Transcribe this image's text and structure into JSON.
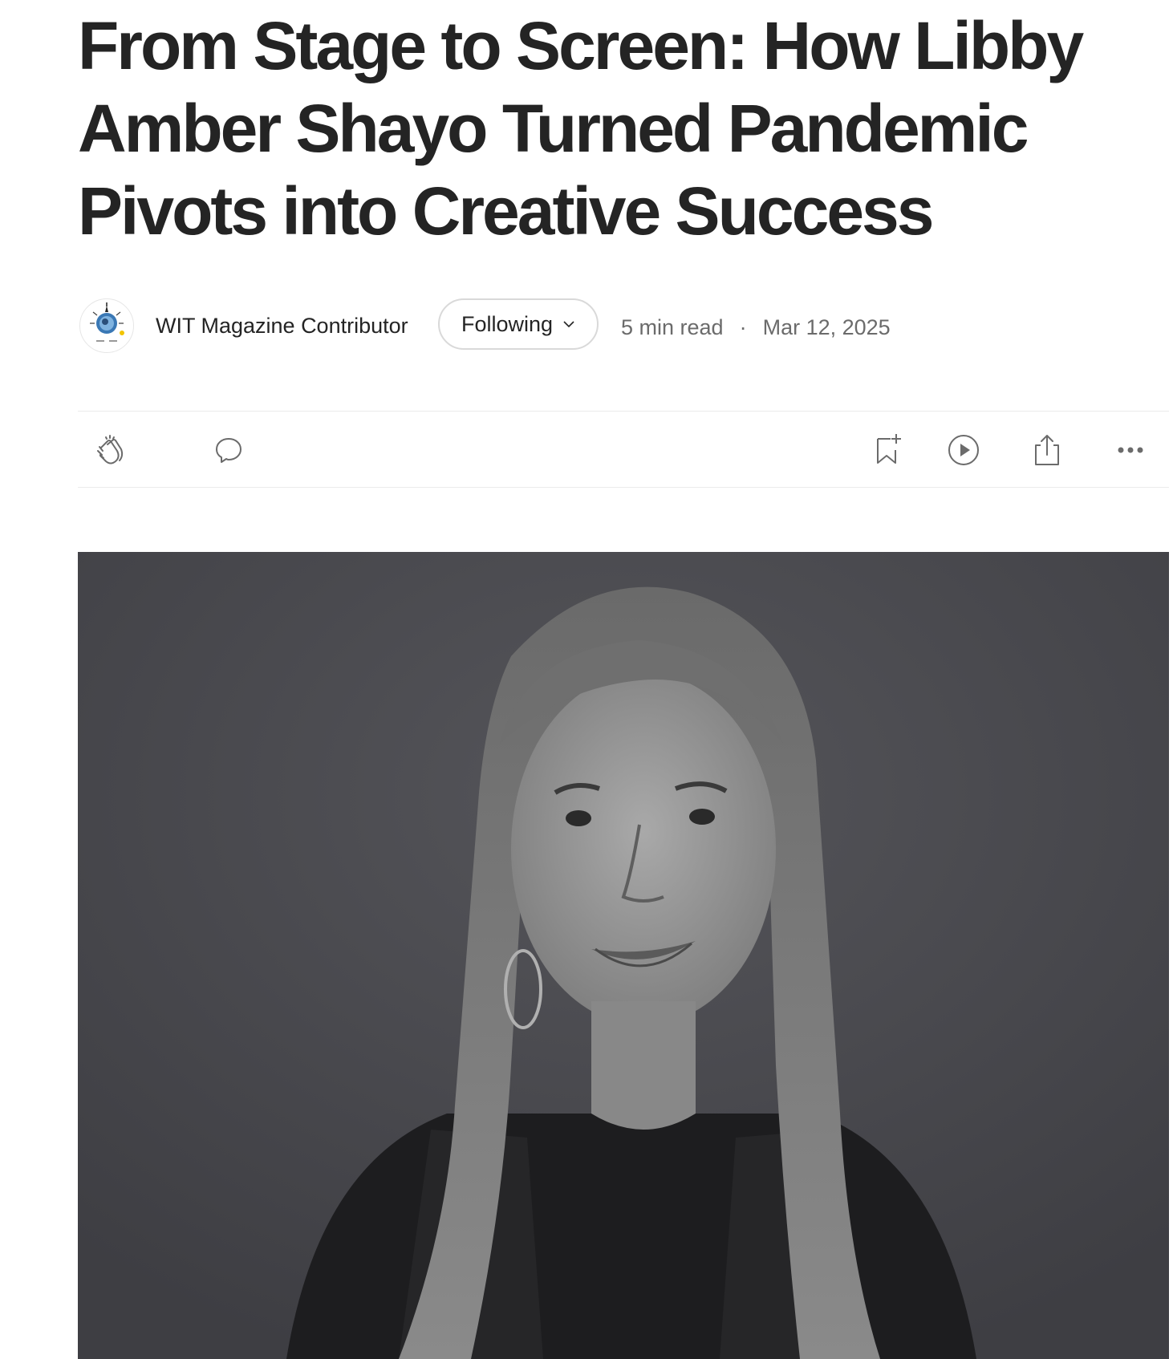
{
  "article": {
    "title": "From Stage to Screen: How Libby Amber Shayo Turned Pandemic Pivots into Creative Success"
  },
  "byline": {
    "author": "WIT Magazine Contributor",
    "follow_label": "Following",
    "read_time": "5 min read",
    "separator": "·",
    "date": "Mar 12, 2025"
  },
  "actions": {
    "icons": [
      "clap-icon",
      "comment-icon",
      "bookmark-add-icon",
      "play-icon",
      "share-icon",
      "more-icon"
    ]
  },
  "hero_image": {
    "alt_semantic": "black-and-white portrait photo"
  },
  "colors": {
    "text": "#242424",
    "muted": "#6b6b6b",
    "border": "#d9d9d9",
    "photo_bg": "#4a4a4f"
  }
}
